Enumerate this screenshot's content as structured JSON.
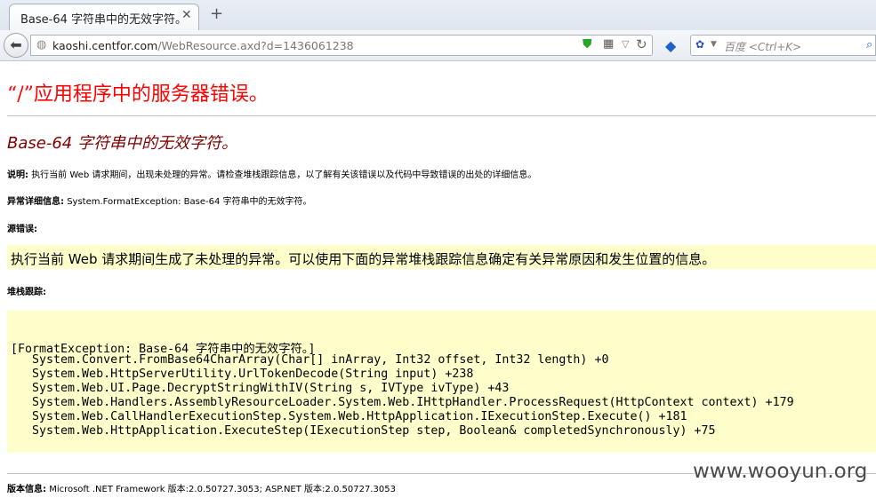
{
  "browser": {
    "tab_title": "Base-64 字符串中的无效字符。",
    "tab_close": "✕",
    "new_tab": "+",
    "url_host": "kaoshi.centfor.com",
    "url_path": "/WebResource.axd?d=1436061238",
    "search_placeholder": "百度 <Ctrl+K>",
    "icons": [
      "back-arrow-icon",
      "globe-icon",
      "shield-icon",
      "qr-code-icon",
      "dropdown-arrow-icon",
      "reload-icon",
      "extension-icon",
      "baidu-paw-icon",
      "search-go-icon"
    ]
  },
  "page": {
    "app_error_title": "“/”应用程序中的服务器错误。",
    "error_heading": "Base-64 字符串中的无效字符。",
    "description_label": "说明:",
    "description_text": "执行当前 Web 请求期间，出现未处理的异常。请检查堆栈跟踪信息，以了解有关该错误以及代码中导致错误的出处的详细信息。",
    "exception_label": "异常详细信息:",
    "exception_text": "System.FormatException: Base-64 字符串中的无效字符。",
    "source_error_label": "源错误:",
    "source_error_text": "执行当前 Web 请求期间生成了未处理的异常。可以使用下面的异常堆栈跟踪信息确定有关异常原因和发生位置的信息。",
    "stack_trace_label": "堆栈跟踪:",
    "stack_trace": [
      "[FormatException: Base-64 字符串中的无效字符。]",
      "   System.Convert.FromBase64CharArray(Char[] inArray, Int32 offset, Int32 length) +0",
      "   System.Web.HttpServerUtility.UrlTokenDecode(String input) +238",
      "   System.Web.UI.Page.DecryptStringWithIV(String s, IVType ivType) +43",
      "   System.Web.Handlers.AssemblyResourceLoader.System.Web.IHttpHandler.ProcessRequest(HttpContext context) +179",
      "   System.Web.CallHandlerExecutionStep.System.Web.HttpApplication.IExecutionStep.Execute() +181",
      "   System.Web.HttpApplication.ExecuteStep(IExecutionStep step, Boolean& completedSynchronously) +75"
    ],
    "version_label": "版本信息:",
    "version_text": "Microsoft .NET Framework 版本:2.0.50727.3053; ASP.NET 版本:2.0.50727.3053"
  },
  "watermark": "www.wooyun.org",
  "colors": {
    "error_title": "#ff0000",
    "error_heading": "#800000",
    "highlight_box": "#ffffcc"
  }
}
